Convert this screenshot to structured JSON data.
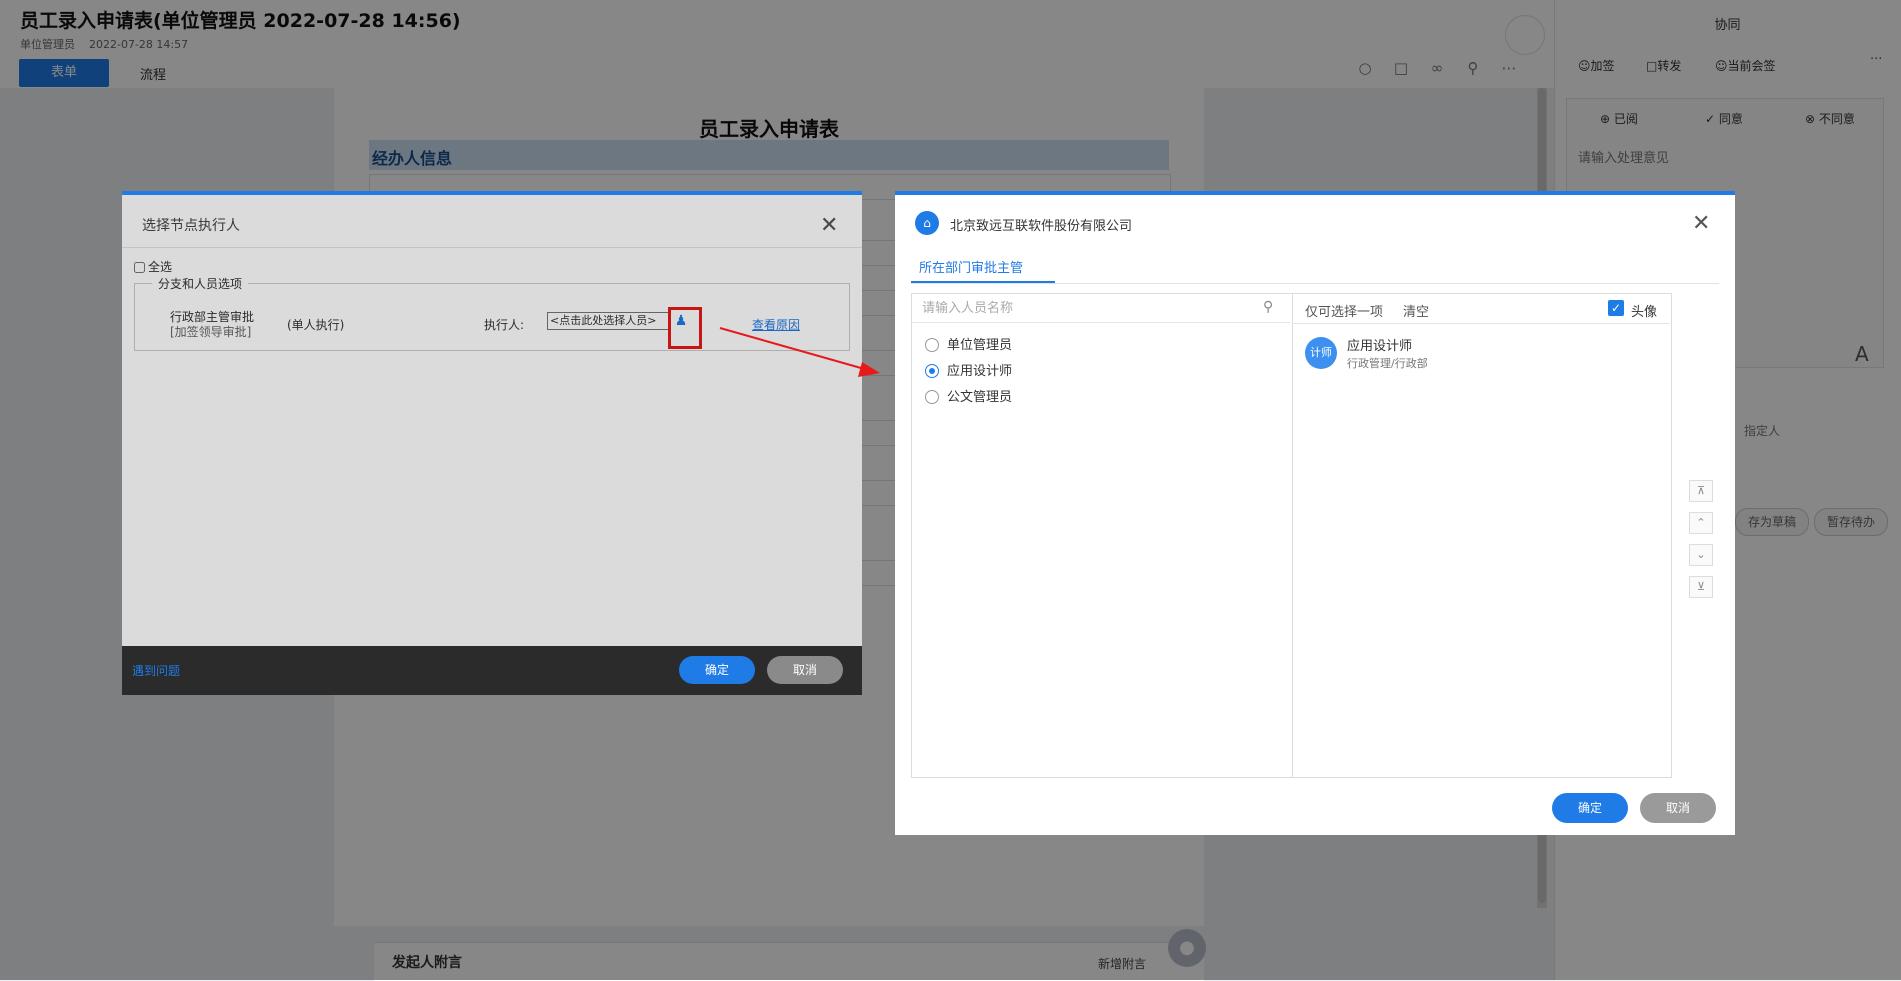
{
  "page": {
    "title": "员工录入申请表(单位管理员 2022-07-28 14:56)",
    "subtitle_user": "单位管理员",
    "subtitle_time": "2022-07-28 14:57",
    "tabs": [
      "表单",
      "流程"
    ],
    "form_title": "员工录入申请表",
    "section_title": "经办人信息",
    "bottom_left": "发起人附言",
    "bottom_right": "新增附言",
    "accent_color": "#1f7be6"
  },
  "right_panel": {
    "title": "协同",
    "actions": [
      "加签",
      "转发",
      "当前会签"
    ],
    "more": "···",
    "opinions": [
      "已阅",
      "同意",
      "不同意"
    ],
    "opinion_placeholder": "请输入处理意见",
    "font_glyph": "A",
    "assign_label": "指定人",
    "buttons": [
      "存为草稿",
      "暂存待办"
    ]
  },
  "dialog_left": {
    "title": "选择节点执行人",
    "select_all": "全选",
    "group_label": "分支和人员选项",
    "node_name": "行政部主管审批",
    "node_sub": "[加签领导审批]",
    "mode": "(单人执行)",
    "exec_label": "执行人:",
    "exec_input_value": "<点击此处选择人员>",
    "reason_link": "查看原因",
    "help_link": "遇到问题",
    "ok": "确定",
    "cancel": "取消",
    "highlight_color": "#e8191a"
  },
  "dialog_right": {
    "org_name": "北京致远互联软件股份有限公司",
    "tab": "所在部门审批主管",
    "search_placeholder": "请输入人员名称",
    "options": [
      {
        "label": "单位管理员",
        "selected": false
      },
      {
        "label": "应用设计师",
        "selected": true
      },
      {
        "label": "公文管理员",
        "selected": false
      }
    ],
    "only_one": "仅可选择一项",
    "clear": "清空",
    "avatar_label": "头像",
    "selected": {
      "avatar_text": "计师",
      "name": "应用设计师",
      "dept": "行政管理/行政部"
    },
    "ok": "确定",
    "cancel": "取消"
  }
}
